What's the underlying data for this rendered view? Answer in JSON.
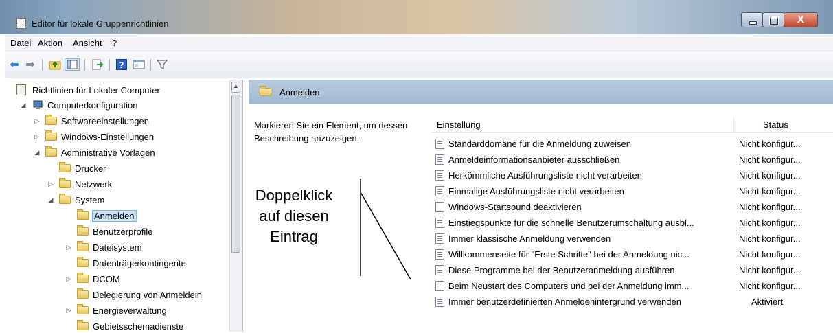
{
  "window": {
    "title": "Editor für lokale Gruppenrichtlinien",
    "close_glyph": "X"
  },
  "menu": [
    "Datei",
    "Aktion",
    "Ansicht",
    "?"
  ],
  "toolbar_icons": [
    "back-arrow-icon",
    "forward-arrow-icon",
    "folder-up-icon",
    "show-hide-tree-icon",
    "export-list-icon",
    "help-icon",
    "properties-icon",
    "filter-icon"
  ],
  "tree": {
    "root": "Richtlinien für Lokaler Computer",
    "items": [
      {
        "label": "Computerkonfiguration"
      },
      {
        "label": "Softwareeinstellungen"
      },
      {
        "label": "Windows-Einstellungen"
      },
      {
        "label": "Administrative Vorlagen"
      },
      {
        "label": "Drucker"
      },
      {
        "label": "Netzwerk"
      },
      {
        "label": "System"
      },
      {
        "label": "Anmelden"
      },
      {
        "label": "Benutzerprofile"
      },
      {
        "label": "Dateisystem"
      },
      {
        "label": "Datenträgerkontingente"
      },
      {
        "label": "DCOM"
      },
      {
        "label": "Delegierung von Anmeldein"
      },
      {
        "label": "Energieverwaltung"
      },
      {
        "label": "Gebietsschemadienste"
      }
    ]
  },
  "right_pane": {
    "header_title": "Anmelden",
    "description": "Markieren Sie ein Element, um dessen Beschreibung anzuzeigen.",
    "columns": {
      "setting": "Einstellung",
      "status": "Status"
    },
    "rows": [
      {
        "name": "Standarddomäne für die Anmeldung zuweisen",
        "status": "Nicht konfigur..."
      },
      {
        "name": "Anmeldeinformationsanbieter ausschließen",
        "status": "Nicht konfigur..."
      },
      {
        "name": "Herkömmliche Ausführungsliste nicht verarbeiten",
        "status": "Nicht konfigur..."
      },
      {
        "name": "Einmalige Ausführungsliste nicht verarbeiten",
        "status": "Nicht konfigur..."
      },
      {
        "name": "Windows-Startsound deaktivieren",
        "status": "Nicht konfigur..."
      },
      {
        "name": "Einstiegspunkte für die schnelle Benutzerumschaltung ausbl...",
        "status": "Nicht konfigur..."
      },
      {
        "name": "Immer klassische Anmeldung verwenden",
        "status": "Nicht konfigur..."
      },
      {
        "name": "Willkommenseite für \"Erste Schritte\" bei der Anmeldung nic...",
        "status": "Nicht konfigur..."
      },
      {
        "name": "Diese Programme bei der Benutzeranmeldung ausführen",
        "status": "Nicht konfigur..."
      },
      {
        "name": "Beim Neustart des Computers und bei der Anmeldung imm...",
        "status": "Nicht konfigur..."
      },
      {
        "name": "Immer benutzerdefinierten Anmeldehintergrund verwenden",
        "status": "Aktiviert"
      }
    ]
  },
  "annotation": {
    "line1": "Doppelklick",
    "line2": "auf diesen",
    "line3": "Eintrag"
  }
}
